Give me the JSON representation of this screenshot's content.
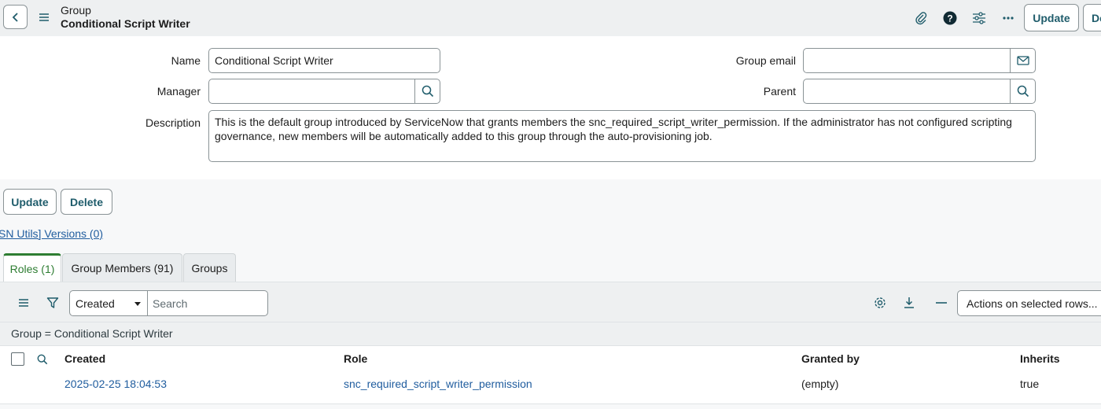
{
  "header": {
    "title_line1": "Group",
    "title_line2": "Conditional Script Writer",
    "update_label": "Update",
    "delete_label": "De"
  },
  "form": {
    "name_label": "Name",
    "name_value": "Conditional Script Writer",
    "manager_label": "Manager",
    "manager_value": "",
    "description_label": "Description",
    "description_value": "This is the default group introduced by ServiceNow that grants members the snc_required_script_writer_permission. If the administrator has not configured scripting governance, new members will be automatically added to this group through the auto-provisioning job.",
    "group_email_label": "Group email",
    "group_email_value": "",
    "parent_label": "Parent",
    "parent_value": ""
  },
  "actions": {
    "update_label": "Update",
    "delete_label": "Delete",
    "versions_link": "SN Utils] Versions (0)"
  },
  "tabs": [
    {
      "label": "Roles (1)",
      "active": true
    },
    {
      "label": "Group Members (91)",
      "active": false
    },
    {
      "label": "Groups",
      "active": false
    }
  ],
  "list": {
    "filter_select_value": "Created",
    "search_placeholder": "Search",
    "actions_select_value": "Actions on selected rows...",
    "breadcrumb": "Group = Conditional Script Writer",
    "columns": [
      "Created",
      "Role",
      "Granted by",
      "Inherits"
    ],
    "rows": [
      [
        "2025-02-25 18:04:53",
        "snc_required_script_writer_permission",
        "(empty)",
        "true"
      ]
    ]
  },
  "colors": {
    "accent": "#1f5c6b",
    "link": "#1f5c9e",
    "active_tab": "#2e7d32",
    "header_bg": "#eef0f1"
  }
}
